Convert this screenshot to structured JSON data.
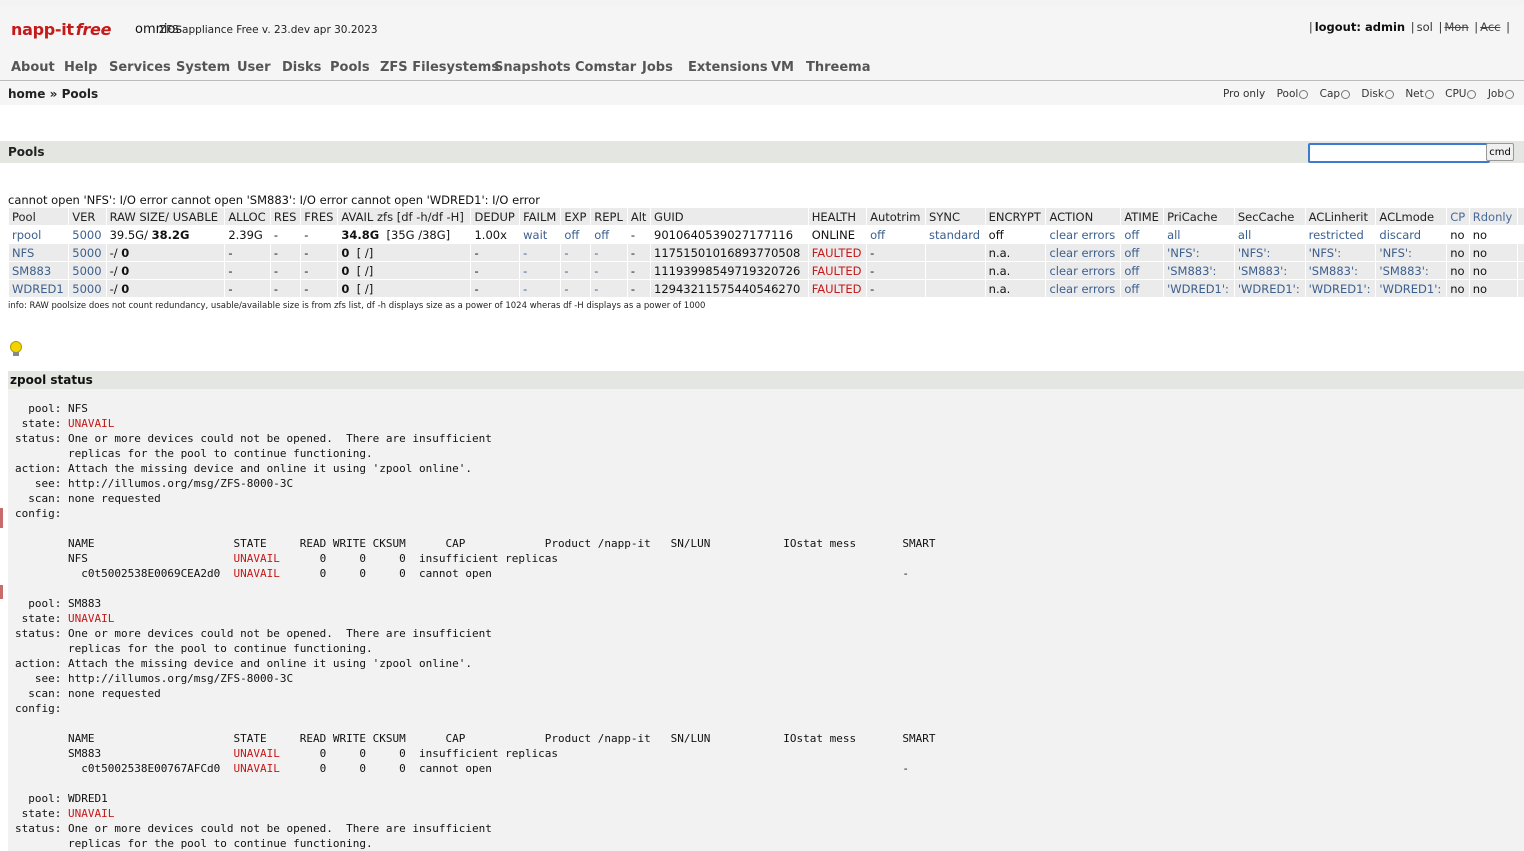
{
  "header": {
    "logo_main": "napp-it",
    "logo_free": "free",
    "product": "omnios",
    "version": "ZFS appliance Free v. 23.dev apr 30.2023",
    "logout_label": "logout: admin",
    "links": [
      "sol",
      "Mon",
      "Acc"
    ]
  },
  "nav": [
    "About",
    "Help",
    "Services",
    "System",
    "User",
    "Disks",
    "Pools",
    "ZFS Filesystems",
    "Snapshots",
    "Comstar",
    "Jobs",
    "Extensions",
    "VM",
    "Threema"
  ],
  "breadcrumb": {
    "home": "home",
    "sep": "»",
    "current": "Pools"
  },
  "monitor": {
    "pro_label": "Pro only",
    "items": [
      "Pool",
      "Cap",
      "Disk",
      "Net",
      "CPU",
      "Job"
    ]
  },
  "pools_section": {
    "title": "Pools",
    "cmd_button": "cmd"
  },
  "error_line": "cannot open 'NFS': I/O error cannot open 'SM883': I/O error cannot open 'WDRED1': I/O error",
  "table": {
    "headers": [
      "Pool",
      "VER",
      "RAW SIZE/ USABLE",
      "ALLOC",
      "RES",
      "FRES",
      "AVAIL zfs [df -h/df -H]",
      "DEDUP",
      "FAILM",
      "EXP",
      "REPL",
      "Alt",
      "GUID",
      "HEALTH",
      "Autotrim",
      "SYNC",
      "ENCRYPT",
      "ACTION",
      "ATIME",
      "PriCache",
      "SecCache",
      "ACLinherit",
      "ACLmode",
      "CP",
      "Rdonly",
      ""
    ],
    "rows": [
      {
        "pool": "rpool",
        "ver": "5000",
        "raw": "39.5G/",
        "usable": "38.2G",
        "alloc": "2.39G",
        "res": "-",
        "fres": "-",
        "avail": "34.8G",
        "avail_df": "[35G /38G]",
        "dedup": "1.00x",
        "failm": "wait",
        "exp": "off",
        "repl": "off",
        "alt": "-",
        "guid": "9010640539027177116",
        "health": "ONLINE",
        "autotrim": "off",
        "sync": "standard",
        "encrypt": "off",
        "action": "clear errors",
        "atime": "off",
        "pricache": "all",
        "seccache": "all",
        "aclinherit": "restricted",
        "aclmode": "discard",
        "cp": "no",
        "rdonly": "no"
      },
      {
        "pool": "NFS",
        "ver": "5000",
        "raw": "-/",
        "usable": "0",
        "alloc": "-",
        "res": "-",
        "fres": "-",
        "avail": "0",
        "avail_df": "[ /]",
        "dedup": "-",
        "failm": "-",
        "exp": "-",
        "repl": "-",
        "alt": "-",
        "guid": "11751501016893770508",
        "health": "FAULTED",
        "autotrim": "-",
        "sync": "",
        "encrypt": "n.a.",
        "action": "clear errors",
        "atime": "off",
        "pricache": "'NFS':",
        "seccache": "'NFS':",
        "aclinherit": "'NFS':",
        "aclmode": "'NFS':",
        "cp": "no",
        "rdonly": "no"
      },
      {
        "pool": "SM883",
        "ver": "5000",
        "raw": "-/",
        "usable": "0",
        "alloc": "-",
        "res": "-",
        "fres": "-",
        "avail": "0",
        "avail_df": "[ /]",
        "dedup": "-",
        "failm": "-",
        "exp": "-",
        "repl": "-",
        "alt": "-",
        "guid": "11193998549719320726",
        "health": "FAULTED",
        "autotrim": "-",
        "sync": "",
        "encrypt": "n.a.",
        "action": "clear errors",
        "atime": "off",
        "pricache": "'SM883':",
        "seccache": "'SM883':",
        "aclinherit": "'SM883':",
        "aclmode": "'SM883':",
        "cp": "no",
        "rdonly": "no"
      },
      {
        "pool": "WDRED1",
        "ver": "5000",
        "raw": "-/",
        "usable": "0",
        "alloc": "-",
        "res": "-",
        "fres": "-",
        "avail": "0",
        "avail_df": "[ /]",
        "dedup": "-",
        "failm": "-",
        "exp": "-",
        "repl": "-",
        "alt": "-",
        "guid": "12943211575440546270",
        "health": "FAULTED",
        "autotrim": "-",
        "sync": "",
        "encrypt": "n.a.",
        "action": "clear errors",
        "atime": "off",
        "pricache": "'WDRED1':",
        "seccache": "'WDRED1':",
        "aclinherit": "'WDRED1':",
        "aclmode": "'WDRED1':",
        "cp": "no",
        "rdonly": "no"
      }
    ]
  },
  "info_line": "info: RAW poolsize does not count redundancy, usable/available size is from zfs list, df -h displays size as a power of 1024 wheras df -H displays as a power of 1000",
  "zpool_status": {
    "title": "zpool status",
    "lines": [
      {
        "t": "  pool: NFS"
      },
      {
        "t": " state: ",
        "r": "UNAVAIL"
      },
      {
        "t": "status: One or more devices could not be opened.  There are insufficient"
      },
      {
        "t": "        replicas for the pool to continue functioning."
      },
      {
        "t": "action: Attach the missing device and online it using 'zpool online'."
      },
      {
        "t": "   see: http://illumos.org/msg/ZFS-8000-3C"
      },
      {
        "t": "  scan: none requested"
      },
      {
        "t": "config:"
      },
      {
        "t": ""
      },
      {
        "t": "        NAME                     STATE     READ WRITE CKSUM      CAP            Product /napp-it   SN/LUN           IOstat mess       SMART"
      },
      {
        "t": "        NFS                      ",
        "r": "UNAVAIL",
        "a": "      0     0     0  insufficient replicas"
      },
      {
        "t": "          c0t5002538E0069CEA2d0  ",
        "r": "UNAVAIL",
        "a": "      0     0     0  cannot open                                                              -"
      },
      {
        "t": ""
      },
      {
        "t": "  pool: SM883"
      },
      {
        "t": " state: ",
        "r": "UNAVAIL"
      },
      {
        "t": "status: One or more devices could not be opened.  There are insufficient"
      },
      {
        "t": "        replicas for the pool to continue functioning."
      },
      {
        "t": "action: Attach the missing device and online it using 'zpool online'."
      },
      {
        "t": "   see: http://illumos.org/msg/ZFS-8000-3C"
      },
      {
        "t": "  scan: none requested"
      },
      {
        "t": "config:"
      },
      {
        "t": ""
      },
      {
        "t": "        NAME                     STATE     READ WRITE CKSUM      CAP            Product /napp-it   SN/LUN           IOstat mess       SMART"
      },
      {
        "t": "        SM883                    ",
        "r": "UNAVAIL",
        "a": "      0     0     0  insufficient replicas"
      },
      {
        "t": "          c0t5002538E00767AFCd0  ",
        "r": "UNAVAIL",
        "a": "      0     0     0  cannot open                                                              -"
      },
      {
        "t": ""
      },
      {
        "t": "  pool: WDRED1"
      },
      {
        "t": " state: ",
        "r": "UNAVAIL"
      },
      {
        "t": "status: One or more devices could not be opened.  There are insufficient"
      },
      {
        "t": "        replicas for the pool to continue functioning."
      }
    ]
  },
  "colors": {
    "accent_red": "#c41a1a",
    "link": "#3b5f8e",
    "bar": "#e4e7e1",
    "focus": "#3b7bd2"
  }
}
